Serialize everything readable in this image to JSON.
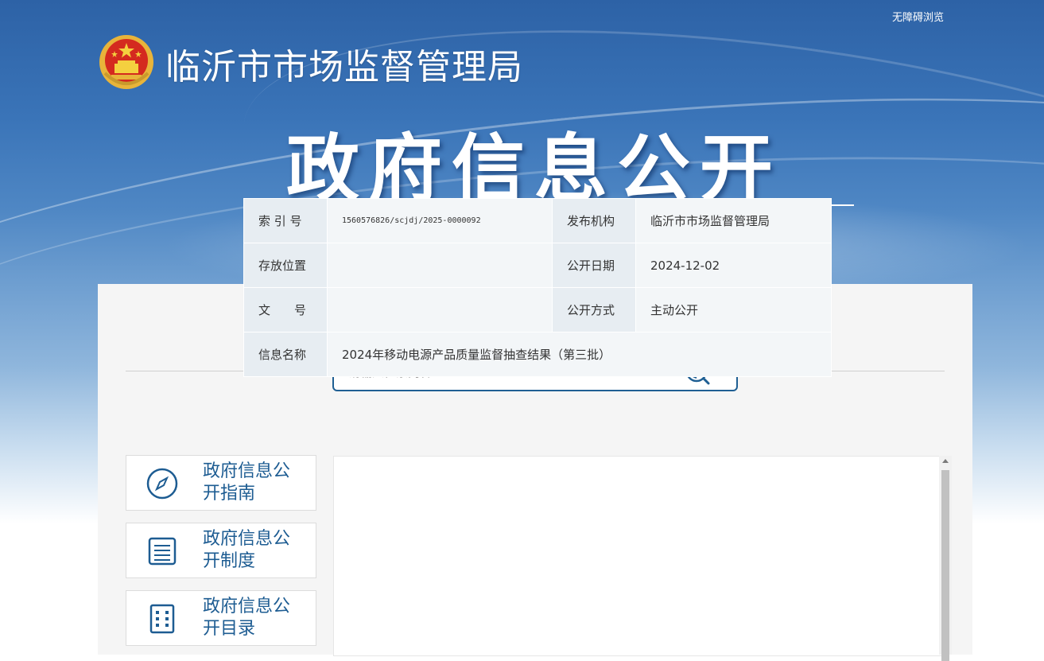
{
  "header": {
    "accessibility_link": "无障碍浏览",
    "site_name": "临沂市市场监督管理局",
    "section_title": "政府信息公开"
  },
  "search": {
    "placeholder": "请输入检索内容",
    "icon": "search-icon"
  },
  "sidebar": {
    "items": [
      {
        "label": "政府信息公开指南",
        "icon": "compass-icon"
      },
      {
        "label": "政府信息公开制度",
        "icon": "document-list-icon"
      },
      {
        "label": "政府信息公开目录",
        "icon": "catalog-grid-icon"
      }
    ]
  },
  "meta": {
    "rows": [
      {
        "k1": "索 引 号",
        "v1": "1560576826/scjdj/2025-0000092",
        "k2": "发布机构",
        "v2": "临沂市市场监督管理局"
      },
      {
        "k1": "存放位置",
        "v1": "",
        "k2": "公开日期",
        "v2": "2024-12-02"
      },
      {
        "k1": "文　　号",
        "v1": "",
        "k2": "公开方式",
        "v2": "主动公开"
      },
      {
        "k1": "信息名称",
        "v1": "2024年移动电源产品质量监督抽查结果（第三批）"
      }
    ]
  },
  "colors": {
    "primary": "#1d5c92",
    "banner_top": "#2d62a6"
  }
}
